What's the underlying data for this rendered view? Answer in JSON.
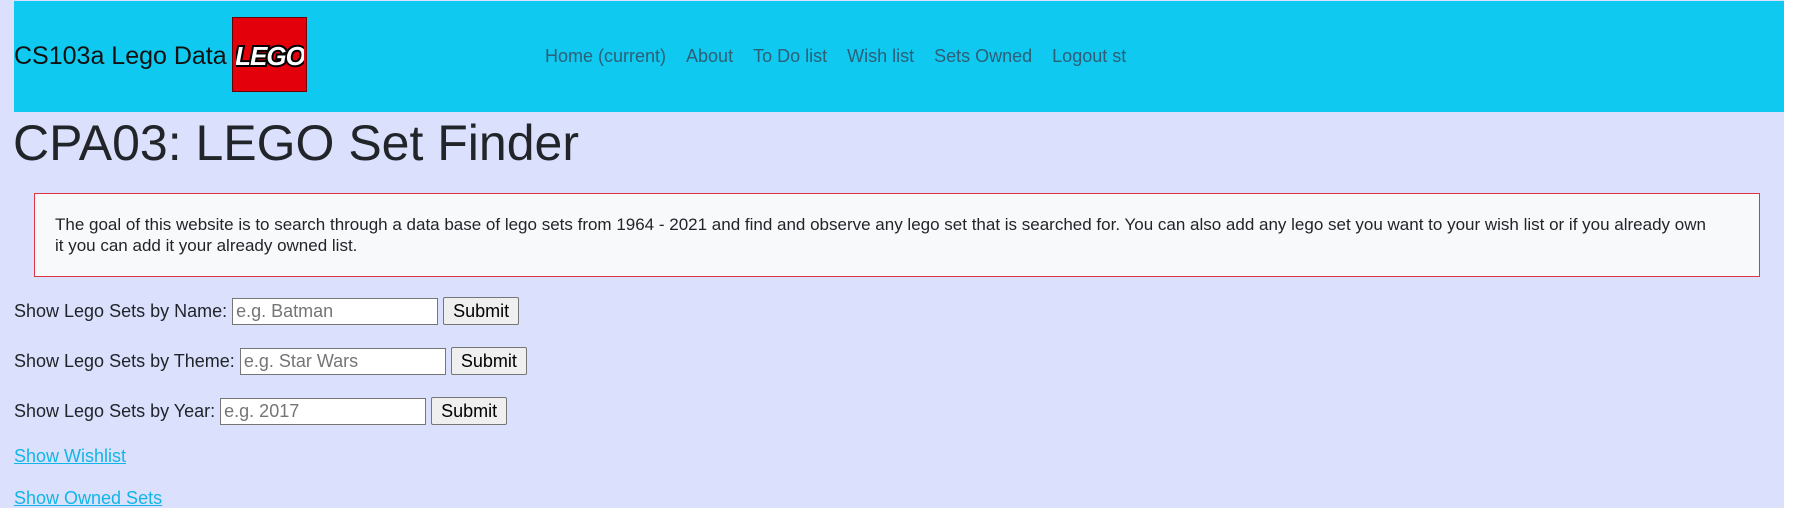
{
  "navbar": {
    "brand": "CS103a Lego Data",
    "logo_text": "LEGO",
    "links": [
      "Home (current)",
      "About",
      "To Do list",
      "Wish list",
      "Sets Owned",
      "Logout st"
    ]
  },
  "main": {
    "title": "CPA03: LEGO Set Finder",
    "intro": "The goal of this website is to search through a data base of lego sets from 1964 - 2021 and find and observe any lego set that is searched for. You can also add any lego set you want to your wish list or if you already own it you can add it your already owned list."
  },
  "forms": [
    {
      "label": "Show Lego Sets by Name:",
      "placeholder": "e.g. Batman",
      "value": "",
      "button": "Submit"
    },
    {
      "label": "Show Lego Sets by Theme:",
      "placeholder": "e.g. Star Wars",
      "value": "",
      "button": "Submit"
    },
    {
      "label": "Show Lego Sets by Year:",
      "placeholder": "e.g. 2017",
      "value": "",
      "button": "Submit"
    }
  ],
  "links": {
    "wishlist": "Show Wishlist",
    "owned": "Show Owned Sets"
  },
  "colors": {
    "navbar": "#0fc9f0",
    "page_background": "#dbe0fd",
    "intro_border": "#dc3545",
    "link": "#12b6e6",
    "logo_red": "#e3000b"
  }
}
